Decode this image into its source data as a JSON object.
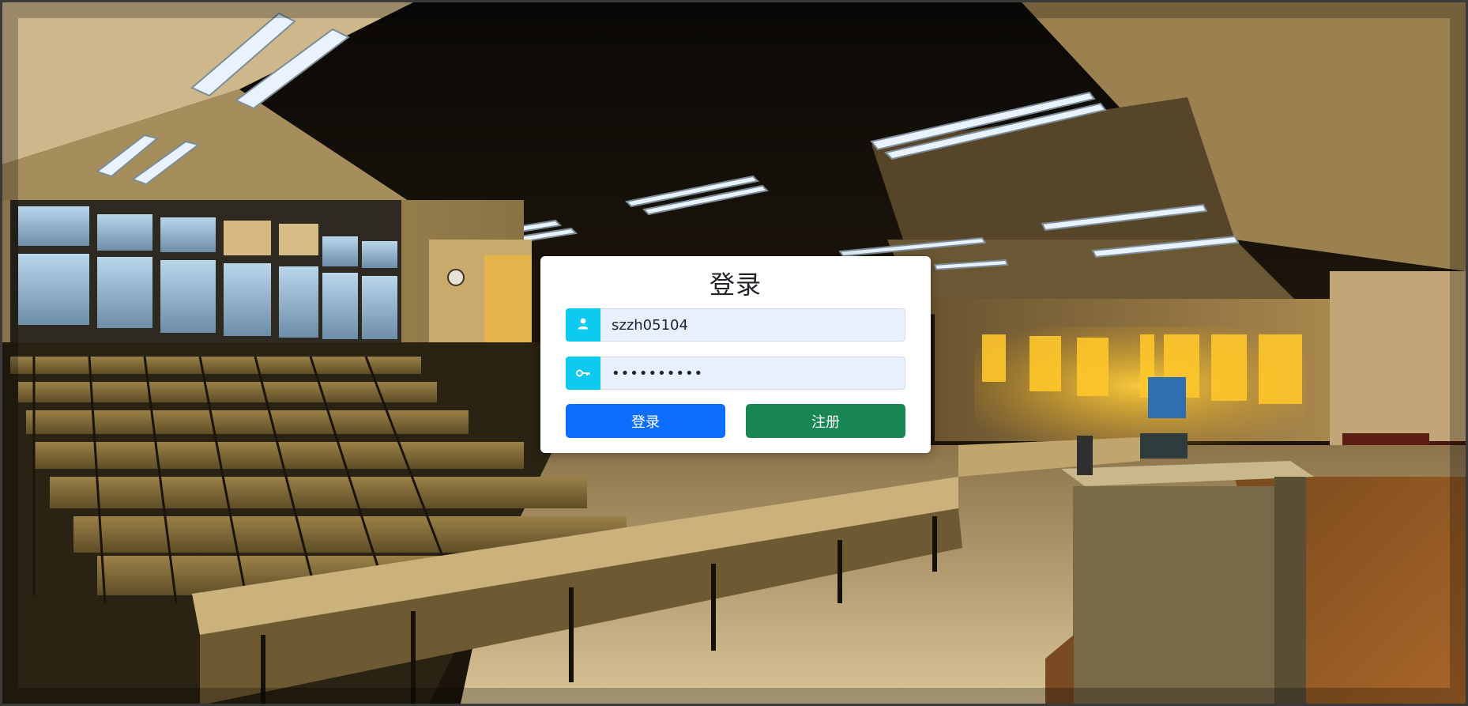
{
  "login_form": {
    "title": "登录",
    "username": {
      "value": "szzh05104",
      "icon": "user-icon"
    },
    "password": {
      "value": "**********",
      "icon": "key-icon"
    },
    "login_button_label": "登录",
    "register_button_label": "注册"
  },
  "colors": {
    "addon": "#0dcaf0",
    "login_button": "#0d6efd",
    "register_button": "#198754",
    "input_background": "#e8f0fe"
  }
}
